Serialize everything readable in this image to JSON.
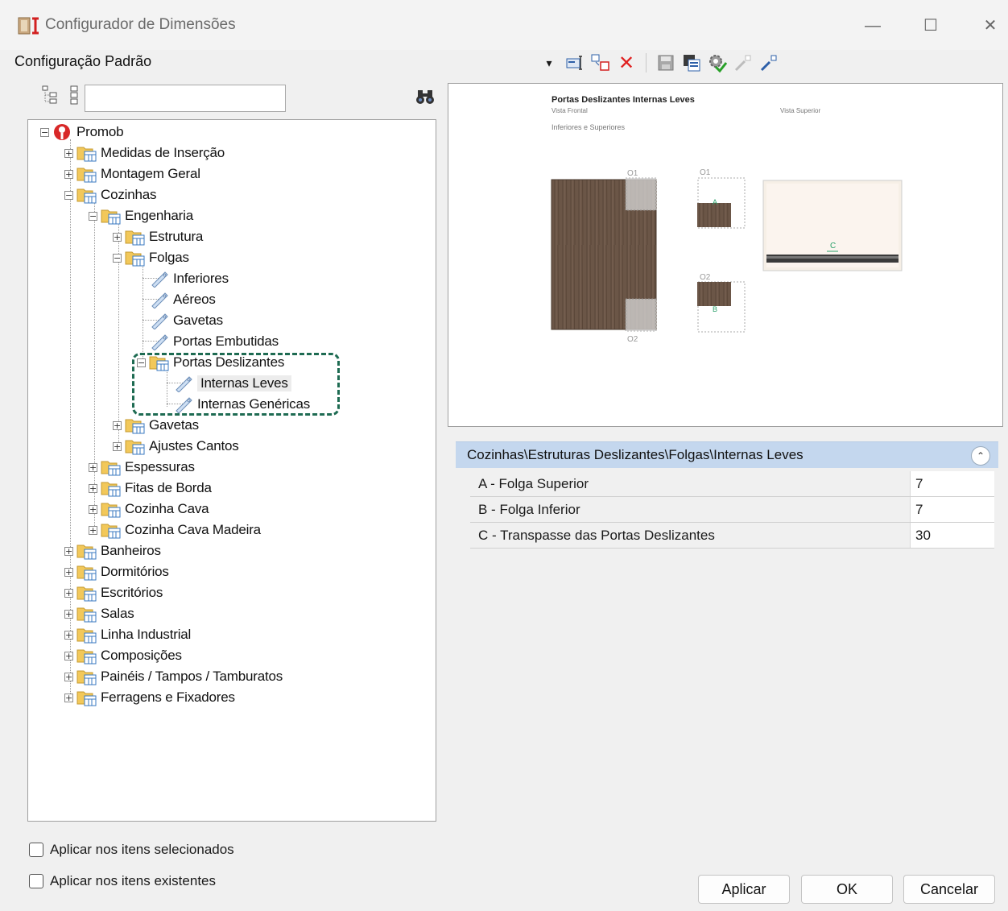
{
  "window": {
    "title": "Configurador de Dimensões",
    "minimize_glyph": "—",
    "maximize_glyph": "☐",
    "close_glyph": "✕"
  },
  "header": {
    "config_label": "Configuração Padrão"
  },
  "toolbar": {
    "icons": [
      "dropdown-arrow-icon",
      "new-config-icon",
      "copy-config-icon",
      "delete-icon",
      "save-icon",
      "save-as-icon",
      "settings-check-icon",
      "export-icon",
      "import-icon"
    ],
    "dropdown_glyph": "▾",
    "delete_glyph": "✕",
    "delete_color": "#e02020"
  },
  "search": {
    "value": "",
    "placeholder": ""
  },
  "tree": {
    "root": "Promob",
    "items": [
      {
        "label": "Medidas de Inserção",
        "toggle": "+"
      },
      {
        "label": "Montagem Geral",
        "toggle": "+"
      },
      {
        "label": "Cozinhas",
        "toggle": "−"
      },
      {
        "label": "Engenharia",
        "toggle": "−"
      },
      {
        "label": "Estrutura",
        "toggle": "+"
      },
      {
        "label": "Folgas",
        "toggle": "−"
      },
      {
        "label": "Inferiores"
      },
      {
        "label": "Aéreos"
      },
      {
        "label": "Gavetas"
      },
      {
        "label": "Portas Embutidas"
      },
      {
        "label": "Portas Deslizantes",
        "toggle": "−"
      },
      {
        "label": "Internas Leves",
        "selected": true
      },
      {
        "label": "Internas Genéricas"
      },
      {
        "label": "Gavetas",
        "toggle": "+"
      },
      {
        "label": "Ajustes Cantos",
        "toggle": "+"
      },
      {
        "label": "Espessuras",
        "toggle": "+"
      },
      {
        "label": "Fitas de Borda",
        "toggle": "+"
      },
      {
        "label": "Cozinha Cava",
        "toggle": "+"
      },
      {
        "label": "Cozinha Cava Madeira",
        "toggle": "+"
      },
      {
        "label": "Banheiros",
        "toggle": "+"
      },
      {
        "label": "Dormitórios",
        "toggle": "+"
      },
      {
        "label": "Escritórios",
        "toggle": "+"
      },
      {
        "label": "Salas",
        "toggle": "+"
      },
      {
        "label": "Linha Industrial",
        "toggle": "+"
      },
      {
        "label": "Composições",
        "toggle": "+"
      },
      {
        "label": "Painéis / Tampos / Tamburatos",
        "toggle": "+"
      },
      {
        "label": "Ferragens e Fixadores",
        "toggle": "+"
      }
    ]
  },
  "preview": {
    "title": "Portas Deslizantes Internas Leves",
    "subtitle": "Vista Frontal",
    "subtitle2": "Inferiores e Superiores",
    "top_view": "Vista Superior",
    "label_o1": "O1",
    "label_o2": "O2",
    "label_o1_small": "O1",
    "label_o2_small": "O2",
    "label_a": "A",
    "label_b": "B",
    "label_c": "C"
  },
  "properties": {
    "path": "Cozinhas\\Estruturas Deslizantes\\Folgas\\Internas Leves",
    "collapse_glyph": "⌃",
    "rows": [
      {
        "name": "A - Folga Superior",
        "value": "7"
      },
      {
        "name": "B - Folga Inferior",
        "value": "7"
      },
      {
        "name": "C - Transpasse das Portas Deslizantes",
        "value": "30"
      }
    ]
  },
  "options": {
    "apply_selected": "Aplicar nos itens selecionados",
    "apply_existing": "Aplicar nos itens existentes"
  },
  "buttons": {
    "apply": "Aplicar",
    "ok": "OK",
    "cancel": "Cancelar"
  },
  "colors": {
    "highlight_border": "#1e6b52",
    "props_header": "#c4d7ee",
    "wood": "#6b5647"
  }
}
